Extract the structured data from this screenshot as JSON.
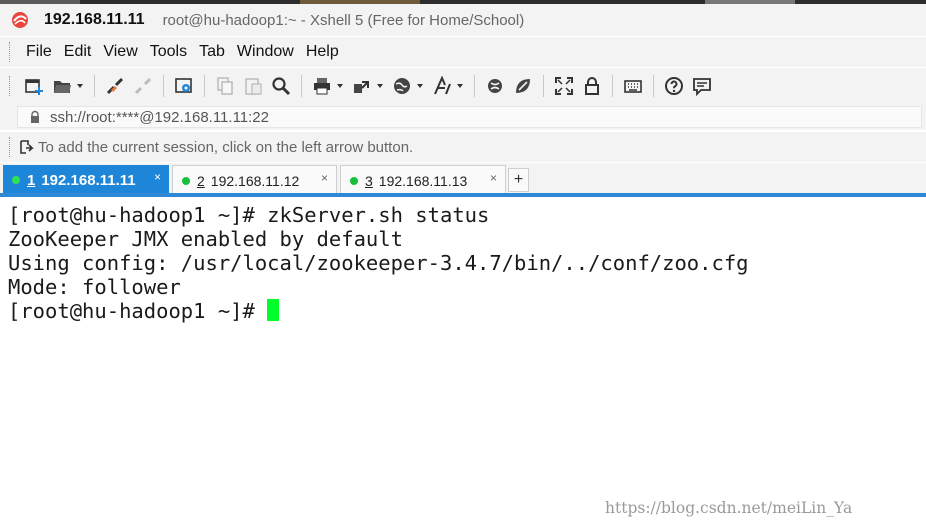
{
  "window": {
    "host": "192.168.11.11",
    "title": "root@hu-hadoop1:~ - Xshell 5 (Free for Home/School)"
  },
  "menu": [
    "File",
    "Edit",
    "View",
    "Tools",
    "Tab",
    "Window",
    "Help"
  ],
  "toolbar": {
    "icons": [
      "new-session-icon",
      "open-folder-icon",
      "reconnect-icon",
      "disconnect-icon",
      "properties-icon",
      "copy-icon",
      "paste-icon",
      "find-icon",
      "print-icon",
      "transfer-icon",
      "globe-icon",
      "font-icon",
      "xftp-icon",
      "xmanager-icon",
      "fullscreen-icon",
      "lock-icon",
      "keyboard-icon",
      "help-icon",
      "chat-icon"
    ]
  },
  "address": {
    "text": "ssh://root:****@192.168.11.11:22"
  },
  "info": {
    "text": "To add the current session, click on the left arrow button."
  },
  "tabs": [
    {
      "number": "1",
      "host": "192.168.11.11",
      "active": true
    },
    {
      "number": "2",
      "host": "192.168.11.12",
      "active": false
    },
    {
      "number": "3",
      "host": "192.168.11.13",
      "active": false
    }
  ],
  "tab_close_glyph": "×",
  "new_tab_glyph": "+",
  "terminal": {
    "lines": [
      "[root@hu-hadoop1 ~]# zkServer.sh status",
      "ZooKeeper JMX enabled by default",
      "Using config: /usr/local/zookeeper-3.4.7/bin/../conf/zoo.cfg",
      "Mode: follower"
    ],
    "prompt": "[root@hu-hadoop1 ~]# "
  },
  "watermark": "https://blog.csdn.net/meiLin_Ya",
  "colors": {
    "accent": "#1e86d8",
    "status_dot": "#17c23a",
    "cursor": "#00ff2a",
    "chrome_bg": "#f3f3f3"
  }
}
